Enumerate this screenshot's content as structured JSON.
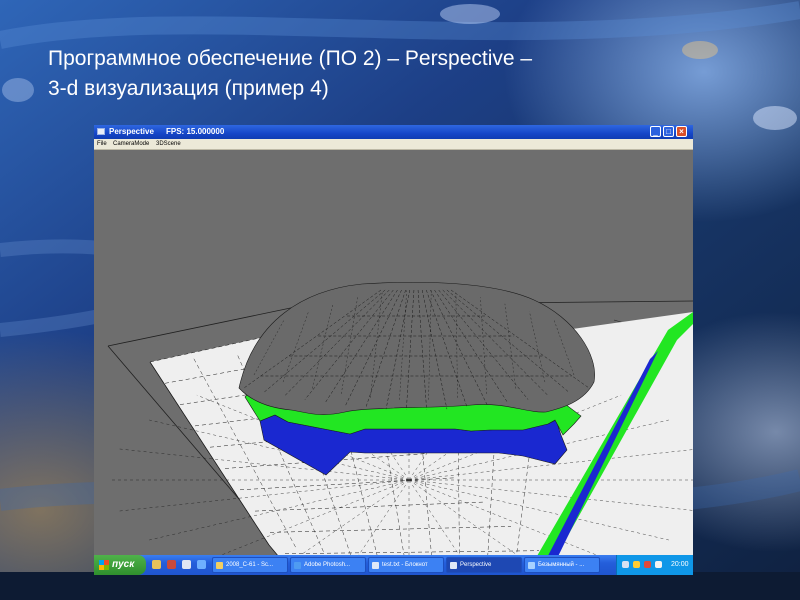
{
  "slide": {
    "title_line1": "Программное обеспечение (ПО 2) – Perspective –",
    "title_line2": "3-d визуализация (пример 4)"
  },
  "window": {
    "title": "Perspective",
    "fps": "FPS: 15.000000",
    "controls": {
      "minimize": "_",
      "maximize": "□",
      "close": "×"
    },
    "menu": [
      "File",
      "CameraMode",
      "3DScene"
    ]
  },
  "scene": {
    "background": "#6e6e6e",
    "floor_color": "#efefef",
    "green_band": "#22e622",
    "blue_band": "#1a28d0",
    "dome_color": "#6a6a6a",
    "wireframe_color": "#1a1a1a"
  },
  "taskbar": {
    "start_label": "пуск",
    "tasks": [
      {
        "label": "2008_C-61 - Sc...",
        "icon": "folder-icon"
      },
      {
        "label": "Adobe Photosh...",
        "icon": "photoshop-icon"
      },
      {
        "label": "test.txt - Блокнот",
        "icon": "notepad-icon"
      },
      {
        "label": "Perspective",
        "icon": "app-window-icon",
        "active": true
      },
      {
        "label": "Безымянный - ...",
        "icon": "paint-icon"
      }
    ],
    "clock": "20:00"
  }
}
